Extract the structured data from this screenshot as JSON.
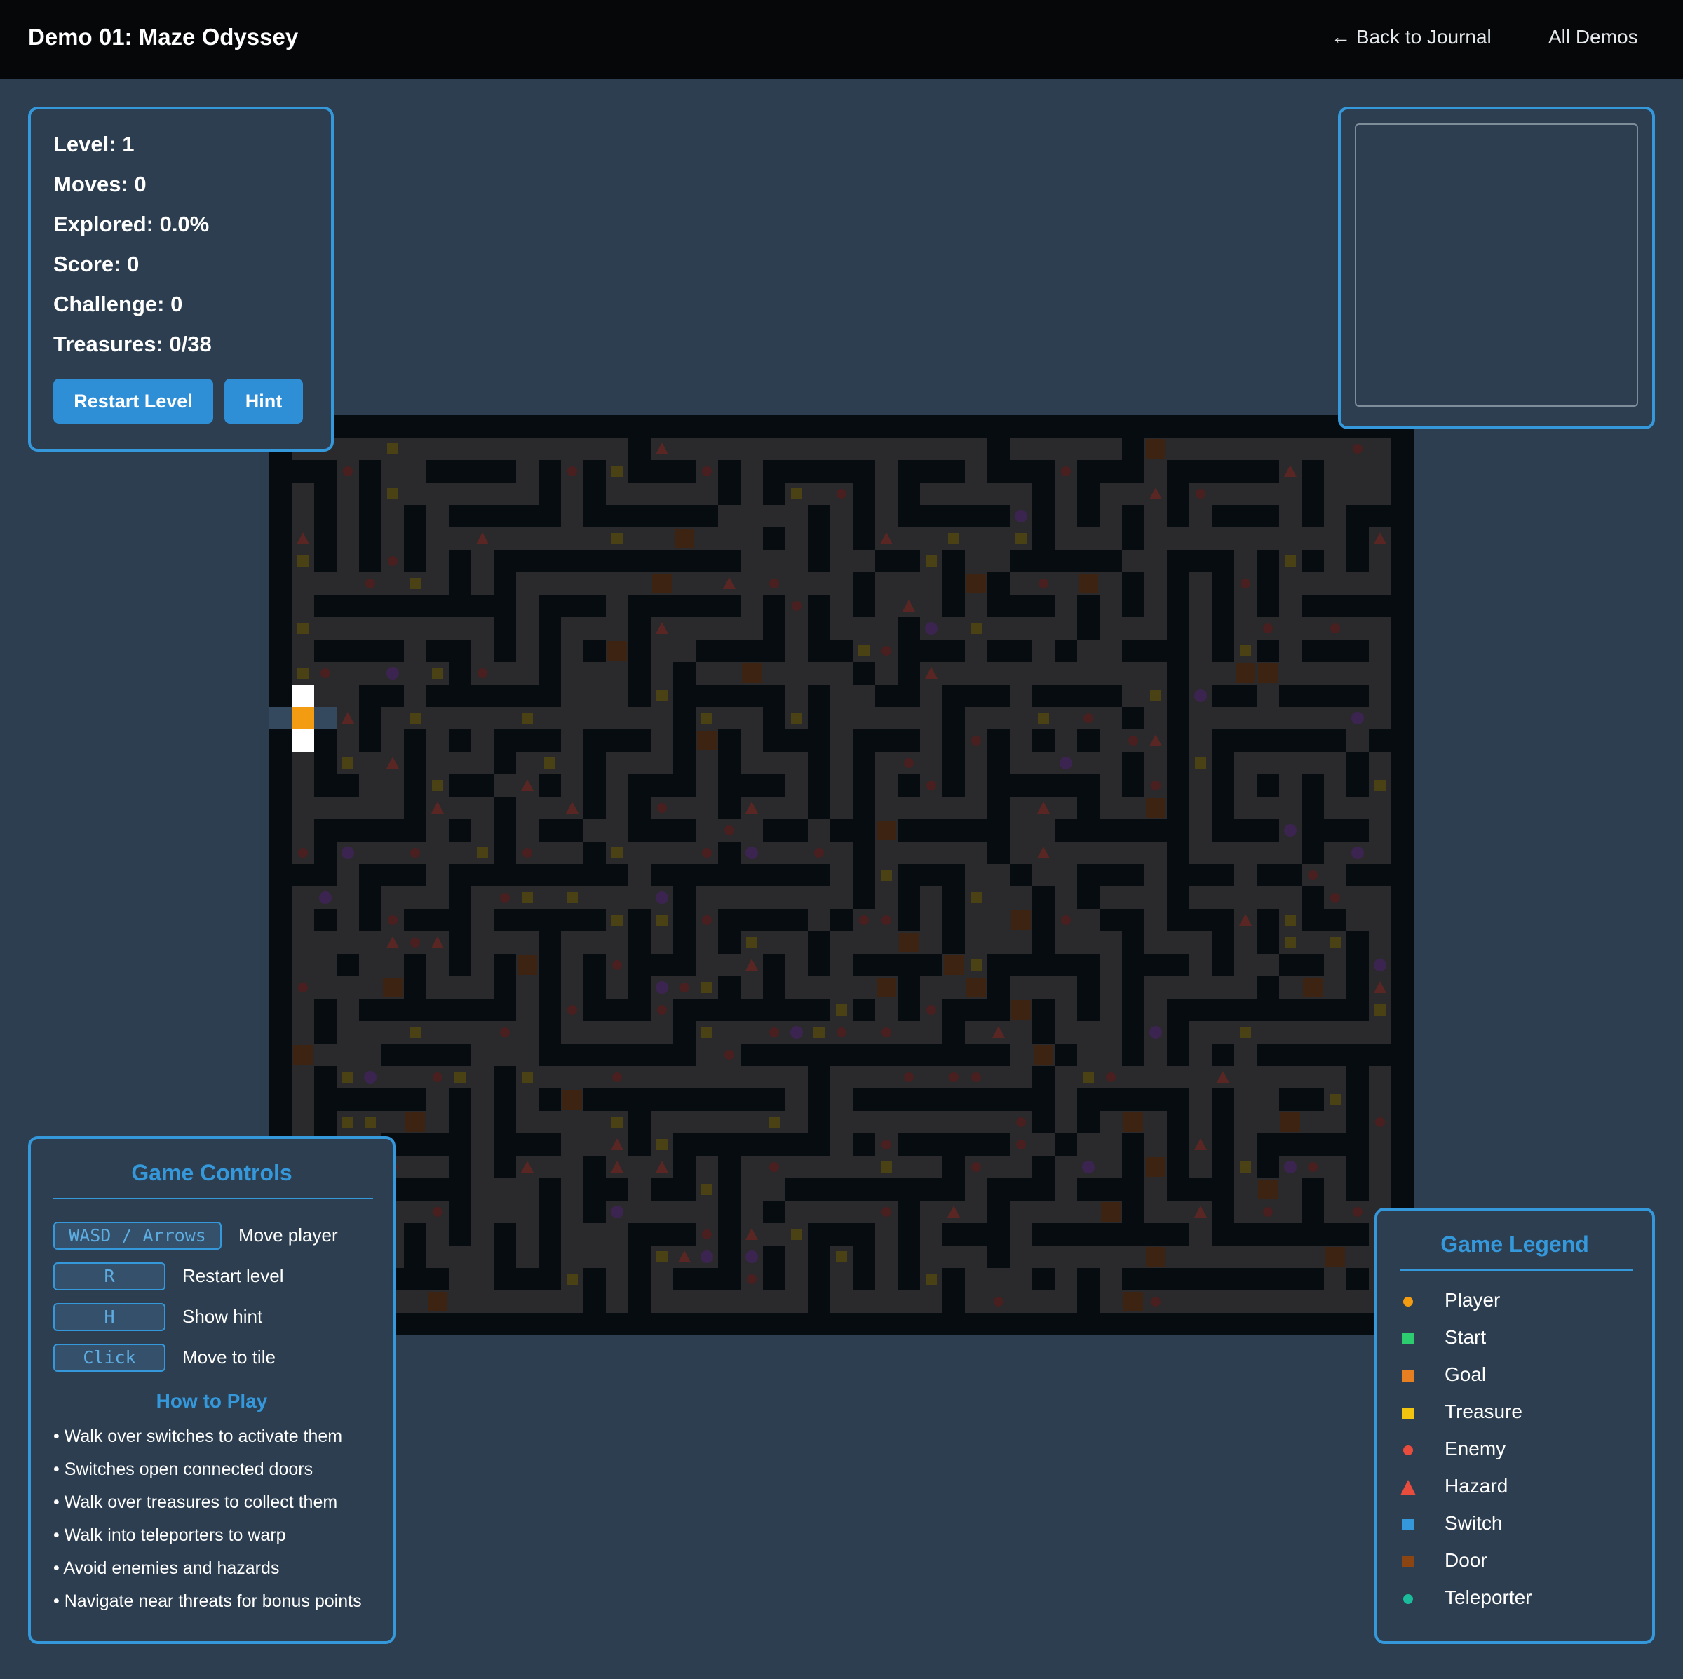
{
  "header": {
    "title": "Demo 01: Maze Odyssey",
    "back_link": "← Back to Journal",
    "demos_link": "All Demos"
  },
  "stats": {
    "level": "Level: 1",
    "moves": "Moves: 0",
    "explored": "Explored: 0.0%",
    "score": "Score: 0",
    "challenge": "Challenge: 0",
    "treasures": "Treasures: 0/38"
  },
  "buttons": {
    "restart": "Restart Level",
    "hint": "Hint"
  },
  "controls": {
    "title": "Game Controls",
    "keys": [
      {
        "key": "WASD / Arrows",
        "action": "Move player"
      },
      {
        "key": "R",
        "action": "Restart level"
      },
      {
        "key": "H",
        "action": "Show hint"
      },
      {
        "key": "Click",
        "action": "Move to tile"
      }
    ],
    "how_title": "How to Play",
    "rules": [
      "• Walk over switches to activate them",
      "• Switches open connected doors",
      "• Walk over treasures to collect them",
      "• Walk into teleporters to warp",
      "• Avoid enemies and hazards",
      "• Navigate near threats for bonus points"
    ]
  },
  "legend": {
    "title": "Game Legend",
    "items": [
      {
        "label": "Player",
        "shape": "circle",
        "color": "#f39c12",
        "icon": "player-icon"
      },
      {
        "label": "Start",
        "shape": "square",
        "color": "#2ecc71",
        "icon": "start-icon"
      },
      {
        "label": "Goal",
        "shape": "square",
        "color": "#e67e22",
        "icon": "goal-icon"
      },
      {
        "label": "Treasure",
        "shape": "square",
        "color": "#f1c40f",
        "icon": "treasure-icon"
      },
      {
        "label": "Enemy",
        "shape": "circle",
        "color": "#e74c3c",
        "icon": "enemy-icon"
      },
      {
        "label": "Hazard",
        "shape": "triangle",
        "color": "#e74c3c",
        "icon": "hazard-icon"
      },
      {
        "label": "Switch",
        "shape": "square",
        "color": "#3498db",
        "icon": "switch-icon"
      },
      {
        "label": "Door",
        "shape": "square",
        "color": "#8b4513",
        "icon": "door-icon"
      },
      {
        "label": "Teleporter",
        "shape": "circle",
        "color": "#1abc9c",
        "icon": "teleporter-icon"
      }
    ]
  },
  "maze": {
    "columns": 51,
    "rows": 41,
    "fog": true,
    "colors": {
      "wall": "#070c10",
      "floor": "#2a2a2d",
      "treasure": "#4a4214",
      "enemy": "#4a1f1f",
      "hazard": "#5a2623",
      "door": "#3d2412",
      "teleporter": "#3c2450",
      "player": "#f39c12",
      "visible": "#ffffff"
    }
  }
}
